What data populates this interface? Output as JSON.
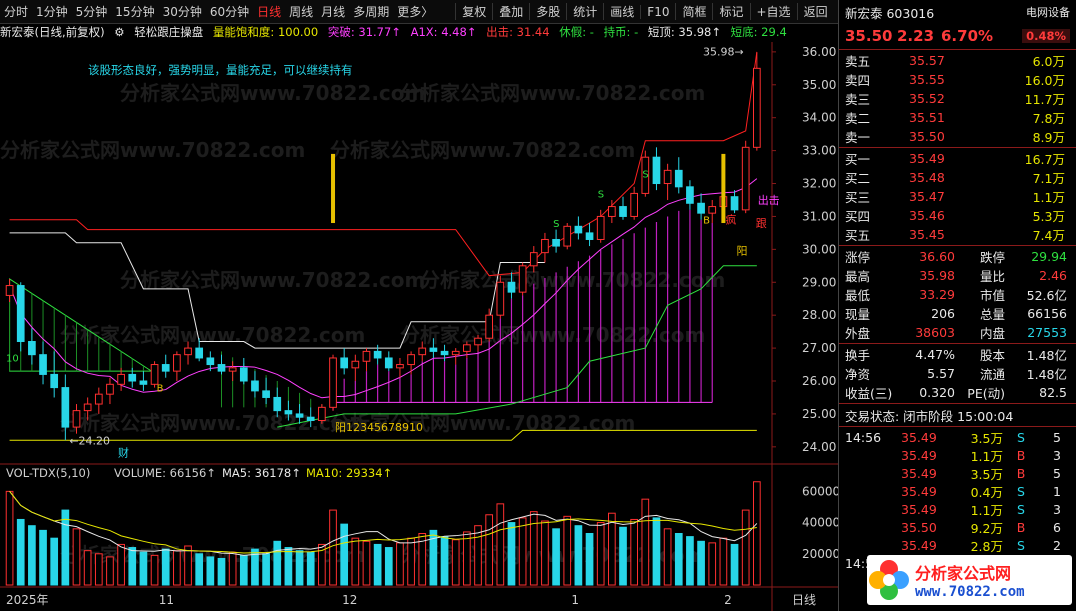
{
  "toolbar": {
    "items": [
      "分时",
      "1分钟",
      "5分钟",
      "15分钟",
      "30分钟",
      "60分钟",
      "日线",
      "周线",
      "月线",
      "多周期",
      "更多〉"
    ],
    "active": "日线",
    "tools": [
      "复权",
      "叠加",
      "多股",
      "统计",
      "画线",
      "F10",
      "简框",
      "标记",
      "+自选",
      "返回"
    ]
  },
  "indicator_line": {
    "stock": "新宏泰(日线,前复权)",
    "gear": "⚙",
    "name": "轻松跟庄操盘",
    "qn": "量能饱和度: 100.00",
    "tp": "突破: 31.77↑",
    "a1x": "A1X: 4.48↑",
    "cj": "出击: 31.44",
    "xj": "休假: -",
    "cb": "持币: -",
    "dd": "短顶: 35.98↑",
    "dx": "短底: 29.4"
  },
  "chart_text": {
    "comment": "该股形态良好，强势明显，量能充足，可以继续持有",
    "watermark": "分析家公式网www.70822.com",
    "high_label": "35.98",
    "low_label": "24.20",
    "cai": "财",
    "yang_numbers": "阳12345678910",
    "yang": "阳",
    "chuji": "出击",
    "gen": "跟",
    "kuang": "疯",
    "b_mark": "B",
    "s_mark": "S",
    "ten_mark": "10"
  },
  "price_axis": {
    "ticks": [
      "36.00",
      "35.00",
      "34.00",
      "33.00",
      "32.00",
      "31.00",
      "30.00",
      "29.00",
      "28.00",
      "27.00",
      "26.00",
      "25.00",
      "24.00"
    ]
  },
  "volume_header": {
    "name": "VOL-TDX(5,10)",
    "volume": "VOLUME: 66156↑",
    "ma5": "MA5: 36178↑",
    "ma10": "MA10: 29334↑"
  },
  "volume_axis": {
    "ticks": [
      "60000",
      "40000",
      "20000"
    ]
  },
  "date_axis": {
    "labels": [
      "2025年",
      "11",
      "12",
      "1",
      "2"
    ],
    "period": "日线"
  },
  "chart_data": {
    "type": "candlestick",
    "title": "新宏泰(日线,前复权)",
    "ylim": [
      23.6,
      36.3
    ],
    "high": 35.98,
    "low": 24.2,
    "candles": [
      [
        28.6,
        29.1,
        28.4,
        28.9
      ],
      [
        28.9,
        29.0,
        26.9,
        27.2
      ],
      [
        27.2,
        27.6,
        26.5,
        26.8
      ],
      [
        26.8,
        27.2,
        25.9,
        26.2
      ],
      [
        26.2,
        26.9,
        25.5,
        25.8
      ],
      [
        25.8,
        26.2,
        24.2,
        24.6
      ],
      [
        24.6,
        25.3,
        24.4,
        25.1
      ],
      [
        25.1,
        25.5,
        24.8,
        25.3
      ],
      [
        25.3,
        25.8,
        25.0,
        25.6
      ],
      [
        25.6,
        26.1,
        25.3,
        25.9
      ],
      [
        25.9,
        26.4,
        25.7,
        26.2
      ],
      [
        26.2,
        26.4,
        25.8,
        26.0
      ],
      [
        26.0,
        26.3,
        25.7,
        25.9
      ],
      [
        25.9,
        26.6,
        25.8,
        26.5
      ],
      [
        26.5,
        26.8,
        26.1,
        26.3
      ],
      [
        26.3,
        26.9,
        26.0,
        26.8
      ],
      [
        26.8,
        27.2,
        26.5,
        27.0
      ],
      [
        27.0,
        27.3,
        26.6,
        26.7
      ],
      [
        26.7,
        26.9,
        26.3,
        26.5
      ],
      [
        26.5,
        26.8,
        26.2,
        26.3
      ],
      [
        26.3,
        26.6,
        26.0,
        26.4
      ],
      [
        26.4,
        26.7,
        25.9,
        26.0
      ],
      [
        26.0,
        26.3,
        25.5,
        25.7
      ],
      [
        25.7,
        26.1,
        25.3,
        25.5
      ],
      [
        25.5,
        25.8,
        24.9,
        25.1
      ],
      [
        25.1,
        25.4,
        24.8,
        25.0
      ],
      [
        25.0,
        25.3,
        24.7,
        24.9
      ],
      [
        24.9,
        25.2,
        24.6,
        24.8
      ],
      [
        24.8,
        25.3,
        24.7,
        25.2
      ],
      [
        25.2,
        26.8,
        25.1,
        26.7
      ],
      [
        26.7,
        27.0,
        26.2,
        26.4
      ],
      [
        26.4,
        26.8,
        26.0,
        26.6
      ],
      [
        26.6,
        27.0,
        26.3,
        26.9
      ],
      [
        26.9,
        27.1,
        26.5,
        26.7
      ],
      [
        26.7,
        26.9,
        26.3,
        26.4
      ],
      [
        26.4,
        26.7,
        26.1,
        26.5
      ],
      [
        26.5,
        26.9,
        26.2,
        26.8
      ],
      [
        26.8,
        27.2,
        26.6,
        27.0
      ],
      [
        27.0,
        27.3,
        26.7,
        26.9
      ],
      [
        26.9,
        27.1,
        26.6,
        26.8
      ],
      [
        26.8,
        27.0,
        26.5,
        26.9
      ],
      [
        26.9,
        27.2,
        26.7,
        27.1
      ],
      [
        27.1,
        27.4,
        26.9,
        27.3
      ],
      [
        27.3,
        28.2,
        27.2,
        28.0
      ],
      [
        28.0,
        29.2,
        27.9,
        29.0
      ],
      [
        29.0,
        29.3,
        28.5,
        28.7
      ],
      [
        28.7,
        29.6,
        28.6,
        29.5
      ],
      [
        29.5,
        30.1,
        29.3,
        29.9
      ],
      [
        29.9,
        30.5,
        29.6,
        30.3
      ],
      [
        30.3,
        30.6,
        29.9,
        30.1
      ],
      [
        30.1,
        30.8,
        30.0,
        30.7
      ],
      [
        30.7,
        31.0,
        30.3,
        30.5
      ],
      [
        30.5,
        30.8,
        30.1,
        30.3
      ],
      [
        30.3,
        31.2,
        30.2,
        31.0
      ],
      [
        31.0,
        31.5,
        30.8,
        31.3
      ],
      [
        31.3,
        31.6,
        30.9,
        31.0
      ],
      [
        31.0,
        31.9,
        30.9,
        31.7
      ],
      [
        31.7,
        33.0,
        31.6,
        32.8
      ],
      [
        32.8,
        33.1,
        31.8,
        32.0
      ],
      [
        32.0,
        32.6,
        31.5,
        32.4
      ],
      [
        32.4,
        32.8,
        31.7,
        31.9
      ],
      [
        31.9,
        32.1,
        31.2,
        31.4
      ],
      [
        31.4,
        31.7,
        30.9,
        31.1
      ],
      [
        31.1,
        31.5,
        30.8,
        31.3
      ],
      [
        31.3,
        31.9,
        31.0,
        31.6
      ],
      [
        31.6,
        31.8,
        31.1,
        31.2
      ],
      [
        31.2,
        33.3,
        31.1,
        33.1
      ],
      [
        33.1,
        35.98,
        33.0,
        35.5
      ]
    ],
    "volume": [
      60000,
      42000,
      38000,
      35000,
      30000,
      48000,
      36000,
      22000,
      20000,
      18000,
      26000,
      24000,
      21000,
      19000,
      23000,
      22000,
      25000,
      20000,
      18000,
      17000,
      21000,
      19000,
      23000,
      20000,
      28000,
      24000,
      22000,
      21000,
      26000,
      48000,
      39000,
      30000,
      28000,
      26000,
      24000,
      27000,
      30000,
      33000,
      35000,
      31000,
      29000,
      34000,
      38000,
      45000,
      52000,
      40000,
      43000,
      47000,
      41000,
      36000,
      44000,
      38000,
      33000,
      40000,
      46000,
      37000,
      42000,
      55000,
      43000,
      36000,
      33000,
      31000,
      28000,
      27000,
      30000,
      26000,
      48000,
      66156
    ]
  },
  "quote": {
    "name": "新宏泰 603016",
    "tag": "电网设备",
    "price": "35.50",
    "change": "2.23",
    "pct": "6.70%",
    "amp": "0.48%",
    "asks": [
      {
        "label": "卖五",
        "price": "35.57",
        "vol": "6.0万"
      },
      {
        "label": "卖四",
        "price": "35.55",
        "vol": "16.0万"
      },
      {
        "label": "卖三",
        "price": "35.52",
        "vol": "11.7万"
      },
      {
        "label": "卖二",
        "price": "35.51",
        "vol": "7.8万"
      },
      {
        "label": "卖一",
        "price": "35.50",
        "vol": "8.9万"
      }
    ],
    "bids": [
      {
        "label": "买一",
        "price": "35.49",
        "vol": "16.7万"
      },
      {
        "label": "买二",
        "price": "35.48",
        "vol": "7.1万"
      },
      {
        "label": "买三",
        "price": "35.47",
        "vol": "1.1万"
      },
      {
        "label": "买四",
        "price": "35.46",
        "vol": "5.3万"
      },
      {
        "label": "买五",
        "price": "35.45",
        "vol": "7.4万"
      }
    ],
    "stats": [
      [
        {
          "k": "涨停",
          "v": "36.60",
          "c": "red"
        },
        {
          "k": "跌停",
          "v": "29.94",
          "c": "green"
        }
      ],
      [
        {
          "k": "最高",
          "v": "35.98",
          "c": "red"
        },
        {
          "k": "量比",
          "v": "2.46",
          "c": "red"
        }
      ],
      [
        {
          "k": "最低",
          "v": "33.29",
          "c": "red"
        },
        {
          "k": "市值",
          "v": "52.6亿",
          "c": "white"
        }
      ],
      [
        {
          "k": "现量",
          "v": "206",
          "c": "white"
        },
        {
          "k": "总量",
          "v": "66156",
          "c": "white"
        }
      ],
      [
        {
          "k": "外盘",
          "v": "38603",
          "c": "red"
        },
        {
          "k": "内盘",
          "v": "27553",
          "c": "cyan"
        }
      ]
    ],
    "stats2": [
      [
        {
          "k": "换手",
          "v": "4.47%"
        },
        {
          "k": "股本",
          "v": "1.48亿"
        }
      ],
      [
        {
          "k": "净资",
          "v": "5.57"
        },
        {
          "k": "流通",
          "v": "1.48亿"
        }
      ],
      [
        {
          "k": "收益(三)",
          "v": "0.320"
        },
        {
          "k": "PE(动)",
          "v": "82.5"
        }
      ]
    ],
    "trade_status": "交易状态: 闭市阶段 15:00:04",
    "trades": [
      {
        "t": "14:56",
        "p": "35.49",
        "v": "3.5万",
        "s": "S",
        "n": "5"
      },
      {
        "t": "",
        "p": "35.49",
        "v": "1.1万",
        "s": "B",
        "n": "3"
      },
      {
        "t": "",
        "p": "35.49",
        "v": "3.5万",
        "s": "B",
        "n": "5"
      },
      {
        "t": "",
        "p": "35.49",
        "v": "0.4万",
        "s": "S",
        "n": "1"
      },
      {
        "t": "",
        "p": "35.49",
        "v": "1.1万",
        "s": "S",
        "n": "3"
      },
      {
        "t": "",
        "p": "35.50",
        "v": "9.2万",
        "s": "B",
        "n": "6"
      },
      {
        "t": "",
        "p": "35.49",
        "v": "2.8万",
        "s": "S",
        "n": "2"
      }
    ],
    "last_time": "14:5",
    "logo": "分析家公式网",
    "logo_url": "www.70822.com"
  }
}
